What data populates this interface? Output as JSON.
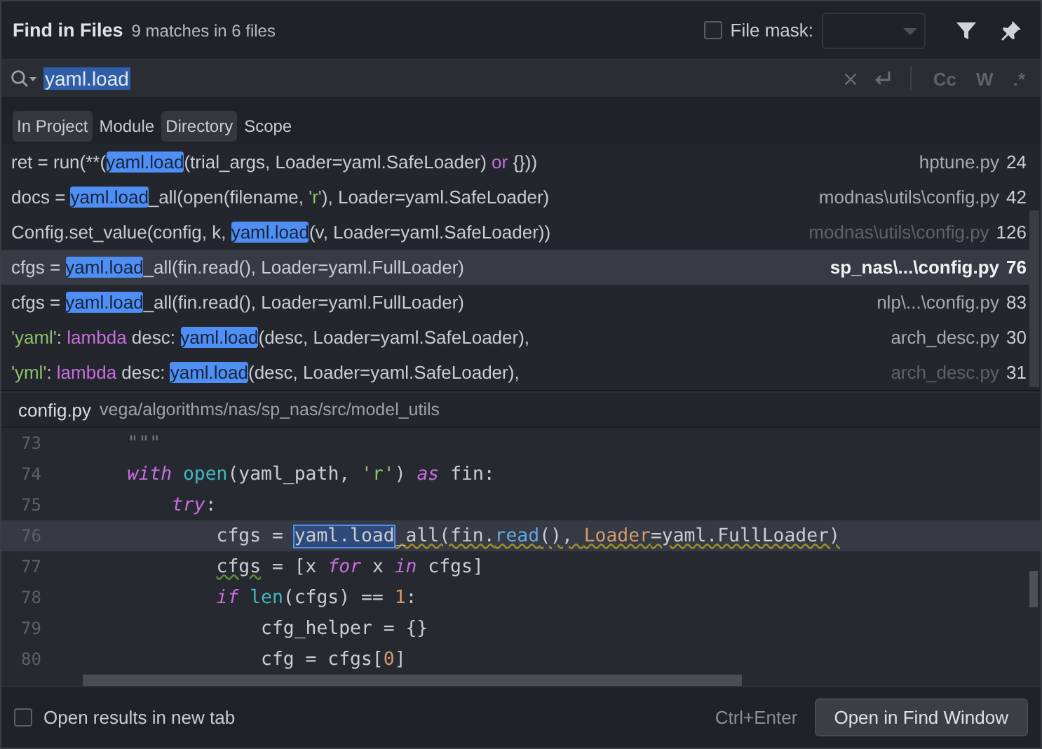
{
  "header": {
    "title": "Find in Files",
    "summary": "9 matches in 6 files",
    "file_mask": {
      "label": "File mask:",
      "checked": false
    }
  },
  "search": {
    "value": "yaml.load",
    "options": [
      {
        "label": "Cc"
      },
      {
        "label": "W"
      },
      {
        "label": ".*"
      }
    ]
  },
  "scopes": [
    {
      "label": "In Project",
      "selected": true
    },
    {
      "label": "Module",
      "selected": false
    },
    {
      "label": "Directory",
      "selected": true
    },
    {
      "label": "Scope",
      "selected": false
    }
  ],
  "results": [
    {
      "selected": false,
      "dimmed": false,
      "file": "hptune.py",
      "line": "24",
      "code": [
        {
          "kind": "plain",
          "text": "ret = run(**("
        },
        {
          "kind": "match",
          "text": "yaml.load"
        },
        {
          "kind": "plain",
          "text": "(trial_args, Loader=yaml.SafeLoader) "
        },
        {
          "kind": "keyword",
          "text": "or"
        },
        {
          "kind": "plain",
          "text": " {}))"
        }
      ]
    },
    {
      "selected": false,
      "dimmed": false,
      "file": "modnas\\utils\\config.py",
      "line": "42",
      "code": [
        {
          "kind": "plain",
          "text": "docs = "
        },
        {
          "kind": "match",
          "text": "yaml.load"
        },
        {
          "kind": "plain",
          "text": "_all(open(filename, "
        },
        {
          "kind": "string",
          "text": "'r'"
        },
        {
          "kind": "plain",
          "text": "), Loader=yaml.SafeLoader)"
        }
      ]
    },
    {
      "selected": false,
      "dimmed": true,
      "file": "modnas\\utils\\config.py",
      "line": "126",
      "code": [
        {
          "kind": "plain",
          "text": "Config.set_value(config, k, "
        },
        {
          "kind": "match",
          "text": "yaml.load"
        },
        {
          "kind": "plain",
          "text": "(v, Loader=yaml.SafeLoader))"
        }
      ]
    },
    {
      "selected": true,
      "dimmed": false,
      "file": "sp_nas\\...\\config.py",
      "line": "76",
      "code": [
        {
          "kind": "plain",
          "text": "cfgs = "
        },
        {
          "kind": "match",
          "text": "yaml.load"
        },
        {
          "kind": "plain",
          "text": "_all(fin.read(), Loader=yaml.FullLoader)"
        }
      ]
    },
    {
      "selected": false,
      "dimmed": false,
      "file": "nlp\\...\\config.py",
      "line": "83",
      "code": [
        {
          "kind": "plain",
          "text": "cfgs = "
        },
        {
          "kind": "match",
          "text": "yaml.load"
        },
        {
          "kind": "plain",
          "text": "_all(fin.read(), Loader=yaml.FullLoader)"
        }
      ]
    },
    {
      "selected": false,
      "dimmed": false,
      "file": "arch_desc.py",
      "line": "30",
      "code": [
        {
          "kind": "string",
          "text": "'yaml'"
        },
        {
          "kind": "plain",
          "text": ": "
        },
        {
          "kind": "keyword",
          "text": "lambda"
        },
        {
          "kind": "plain",
          "text": " desc: "
        },
        {
          "kind": "match",
          "text": "yaml.load"
        },
        {
          "kind": "plain",
          "text": "(desc, Loader=yaml.SafeLoader),"
        }
      ]
    },
    {
      "selected": false,
      "dimmed": true,
      "file": "arch_desc.py",
      "line": "31",
      "code": [
        {
          "kind": "string",
          "text": "'yml'"
        },
        {
          "kind": "plain",
          "text": ": "
        },
        {
          "kind": "keyword",
          "text": "lambda"
        },
        {
          "kind": "plain",
          "text": " desc: "
        },
        {
          "kind": "match",
          "text": "yaml.load"
        },
        {
          "kind": "plain",
          "text": "(desc, Loader=yaml.SafeLoader),"
        }
      ]
    }
  ],
  "preview": {
    "file": "config.py",
    "path": "vega/algorithms/nas/sp_nas/src/model_utils",
    "lines": [
      {
        "number": "73",
        "current": false,
        "code": [
          {
            "kind": "comment",
            "text": "    \"\"\""
          }
        ]
      },
      {
        "number": "74",
        "current": false,
        "code": [
          {
            "kind": "keyword",
            "text": "    with "
          },
          {
            "kind": "builtin",
            "text": "open"
          },
          {
            "kind": "plain",
            "text": "(yaml_path, "
          },
          {
            "kind": "string",
            "text": "'r'"
          },
          {
            "kind": "plain",
            "text": ") "
          },
          {
            "kind": "keyword",
            "text": "as"
          },
          {
            "kind": "plain",
            "text": " fin:"
          }
        ]
      },
      {
        "number": "75",
        "current": false,
        "code": [
          {
            "kind": "keyword",
            "text": "        try"
          },
          {
            "kind": "plain",
            "text": ":"
          }
        ]
      },
      {
        "number": "76",
        "current": true,
        "code": [
          {
            "kind": "plain",
            "text": "            cfgs = "
          },
          {
            "kind": "match",
            "text": "yaml.load"
          },
          {
            "kind": "warn",
            "text": "_all(fin."
          },
          {
            "kind": "warnmethod",
            "text": "read"
          },
          {
            "kind": "warn",
            "text": "(), "
          },
          {
            "kind": "warnparam",
            "text": "Loader"
          },
          {
            "kind": "warn",
            "text": "=yaml.FullLoader)"
          }
        ]
      },
      {
        "number": "77",
        "current": false,
        "code": [
          {
            "kind": "typo",
            "text": "            cfgs"
          },
          {
            "kind": "plain",
            "text": " = [x "
          },
          {
            "kind": "keyword",
            "text": "for"
          },
          {
            "kind": "plain",
            "text": " x "
          },
          {
            "kind": "keyword",
            "text": "in"
          },
          {
            "kind": "plain",
            "text": " cfgs]"
          }
        ]
      },
      {
        "number": "78",
        "current": false,
        "code": [
          {
            "kind": "keyword",
            "text": "            if "
          },
          {
            "kind": "builtin",
            "text": "len"
          },
          {
            "kind": "plain",
            "text": "(cfgs) == "
          },
          {
            "kind": "number",
            "text": "1"
          },
          {
            "kind": "plain",
            "text": ":"
          }
        ]
      },
      {
        "number": "79",
        "current": false,
        "code": [
          {
            "kind": "plain",
            "text": "                cfg_helper = {}"
          }
        ]
      },
      {
        "number": "80",
        "current": false,
        "code": [
          {
            "kind": "plain",
            "text": "                cfg = cfgs["
          },
          {
            "kind": "number",
            "text": "0"
          },
          {
            "kind": "plain",
            "text": "]"
          }
        ]
      }
    ]
  },
  "footer": {
    "new_tab": {
      "label": "Open results in new tab",
      "checked": false
    },
    "shortcut": "Ctrl+Enter",
    "button": "Open in Find Window"
  }
}
